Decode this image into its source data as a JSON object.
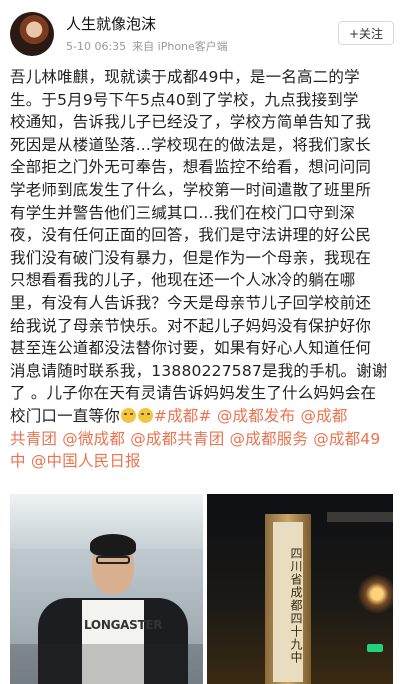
{
  "post": {
    "author": "人生就像泡沫",
    "timestamp": "5-10 06:35",
    "source": "来自 iPhone客户端",
    "follow_label": "+关注",
    "content_lines": [
      [
        {
          "t": "吾儿林唯麒，现就读于成都49中，是一名高二的学"
        }
      ],
      [
        {
          "t": "生。于5月9号下午5点40到了学校，九点我接到学"
        }
      ],
      [
        {
          "t": "校通知，告诉我儿子已经没了，学校方简单告知了我"
        }
      ],
      [
        {
          "t": "死因是从楼道坠落...学校现在的做法是，将我们家长"
        }
      ],
      [
        {
          "t": "全部拒之门外无可奉告，想看监控不给看，想问问同"
        }
      ],
      [
        {
          "t": "学老师到底发生了什么，学校第一时间遣散了班里所"
        }
      ],
      [
        {
          "t": "有学生并警告他们三缄其口...我们在校门口守到深"
        }
      ],
      [
        {
          "t": "夜，没有任何正面的回答，我们是守法讲理的好公民"
        }
      ],
      [
        {
          "t": "我们没有破门没有暴力，但是作为一个母亲，我现在"
        }
      ],
      [
        {
          "t": "只想看看我的儿子，他现在还一个人冰冷的躺在哪"
        }
      ],
      [
        {
          "t": "里，有没有人告诉我？今天是母亲节儿子回学校前还"
        }
      ],
      [
        {
          "t": "给我说了母亲节快乐。对不起儿子妈妈没有保护好你"
        }
      ],
      [
        {
          "t": "甚至连公道都没法替你讨要，如果有好心人知道任何"
        }
      ],
      [
        {
          "t": "消息请随时联系我，13880227587是我的手机。谢谢"
        }
      ],
      [
        {
          "t": "了 。儿子你在天有灵请告诉妈妈发生了什么妈妈会在"
        }
      ],
      [
        {
          "t": "校门口一直等你"
        },
        {
          "emoji": "cry-face-icon"
        },
        {
          "emoji": "cry-face-icon"
        },
        {
          "t": "#成都#",
          "link": true
        },
        {
          "t": " "
        },
        {
          "t": "@成都发布",
          "link": true
        },
        {
          "t": " "
        },
        {
          "t": "@成都",
          "link": true
        }
      ],
      [
        {
          "t": "共青团",
          "link": true
        },
        {
          "t": " "
        },
        {
          "t": "@微成都",
          "link": true
        },
        {
          "t": " "
        },
        {
          "t": "@成都共青团",
          "link": true
        },
        {
          "t": " "
        },
        {
          "t": "@成都服务",
          "link": true
        },
        {
          "t": " "
        },
        {
          "t": "@成都49",
          "link": true
        }
      ],
      [
        {
          "t": "中",
          "link": true
        },
        {
          "t": " "
        },
        {
          "t": "@中国人民日报",
          "link": true
        }
      ]
    ],
    "images": {
      "left_shirt_text": "LONGASTER",
      "right_plaque_text": "四川省成都四十九中"
    }
  },
  "colors": {
    "link": "#eb7350",
    "meta": "#999999"
  }
}
